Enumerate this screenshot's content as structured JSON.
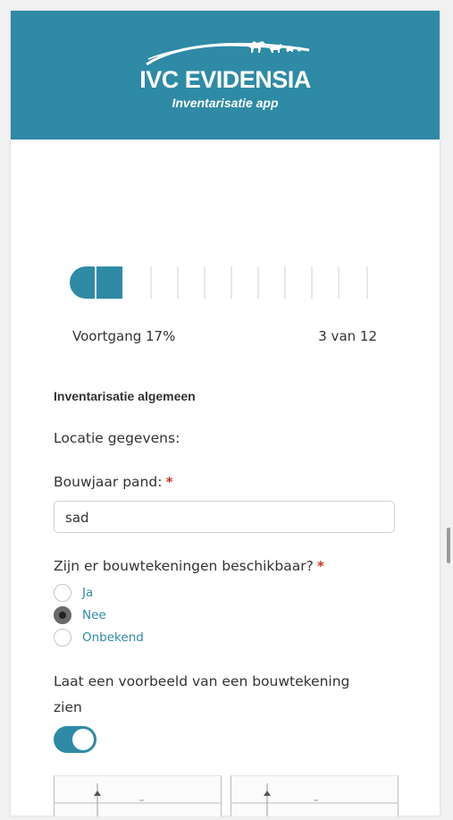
{
  "brand": {
    "name": "IVC EVIDENSIA",
    "app_subtitle": "Inventarisatie app",
    "color": "#2f8aa6"
  },
  "progress": {
    "label": "Voortgang 17%",
    "percent": 17,
    "step_text": "3 van 12",
    "current_step": 3,
    "total_steps": 12
  },
  "form": {
    "section_title": "Inventarisatie algemeen",
    "location_label": "Locatie gegevens:",
    "year_built": {
      "label": "Bouwjaar pand:",
      "required_mark": "*",
      "value": "sad"
    },
    "drawings_available": {
      "question": "Zijn er bouwtekeningen beschikbaar?",
      "required_mark": "*",
      "options": [
        {
          "label": "Ja",
          "selected": false
        },
        {
          "label": "Nee",
          "selected": true
        },
        {
          "label": "Onbekend",
          "selected": false
        }
      ]
    },
    "show_example": {
      "label_line1": "Laat een voorbeeld van een bouwtekening",
      "label_line2": "zien",
      "enabled": true
    }
  },
  "icons": [
    "horse-dog-logo-icon"
  ]
}
